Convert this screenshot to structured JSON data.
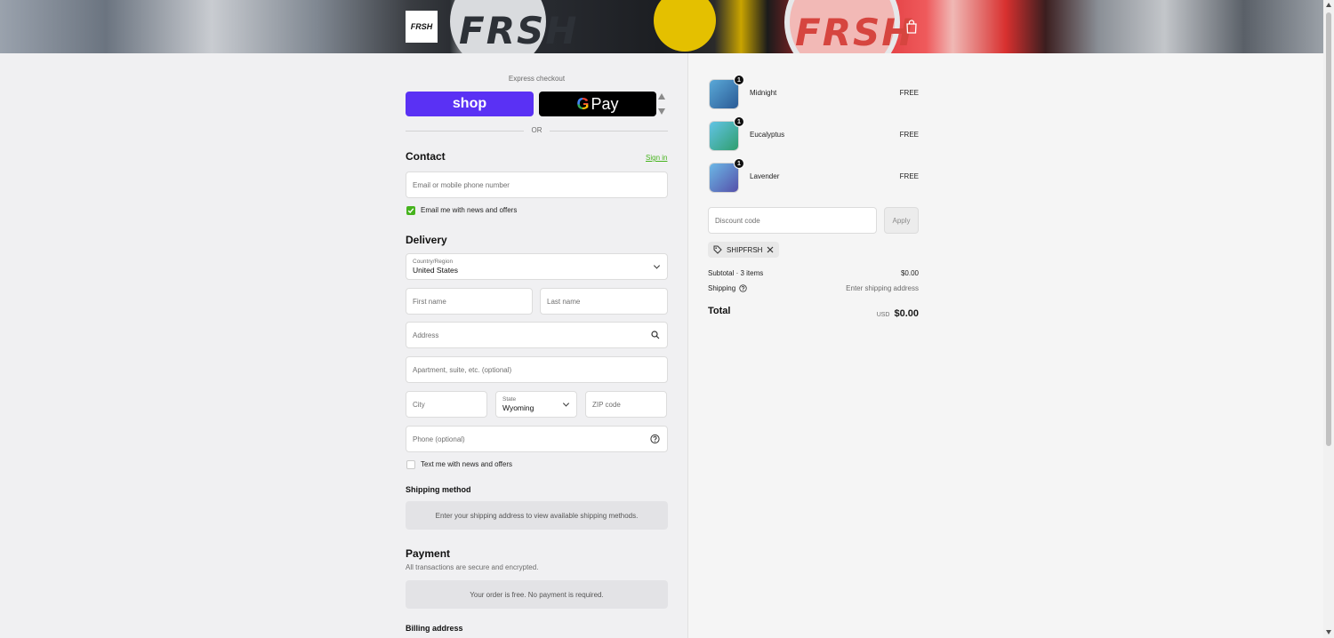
{
  "header": {
    "logo_text": "FRSH",
    "hero_brand": "FRSH",
    "cart_icon": "shopping-bag-icon"
  },
  "express": {
    "label": "Express checkout",
    "shop_label": "shop",
    "gpay_g": "G",
    "gpay_label": "Pay",
    "or_label": "OR"
  },
  "contact": {
    "title": "Contact",
    "sign_in": "Sign in",
    "email_placeholder": "Email or mobile phone number",
    "newsletter_label": "Email me with news and offers",
    "newsletter_checked": true
  },
  "delivery": {
    "title": "Delivery",
    "country_label": "Country/Region",
    "country_value": "United States",
    "first_name_placeholder": "First name",
    "last_name_placeholder": "Last name",
    "address_placeholder": "Address",
    "apartment_placeholder": "Apartment, suite, etc. (optional)",
    "city_placeholder": "City",
    "state_label": "State",
    "state_value": "Wyoming",
    "zip_placeholder": "ZIP code",
    "phone_placeholder": "Phone (optional)",
    "sms_label": "Text me with news and offers",
    "sms_checked": false
  },
  "shipping_method": {
    "title": "Shipping method",
    "message": "Enter your shipping address to view available shipping methods."
  },
  "payment": {
    "title": "Payment",
    "subtitle": "All transactions are secure and encrypted.",
    "message": "Your order is free. No payment is required."
  },
  "billing": {
    "title": "Billing address"
  },
  "summary": {
    "items": [
      {
        "name": "Midnight",
        "qty": "1",
        "price": "FREE",
        "color": "#3b6fa6"
      },
      {
        "name": "Eucalyptus",
        "qty": "1",
        "price": "FREE",
        "color": "#3aa07a"
      },
      {
        "name": "Lavender",
        "qty": "1",
        "price": "FREE",
        "color": "#5a5fb0"
      }
    ],
    "discount_placeholder": "Discount code",
    "apply_label": "Apply",
    "discount_chip": "SHIPFRSH",
    "subtotal_label": "Subtotal · 3 items",
    "subtotal_value": "$0.00",
    "shipping_label": "Shipping",
    "shipping_value": "Enter shipping address",
    "total_label": "Total",
    "total_currency": "USD",
    "total_value": "$0.00"
  },
  "colors": {
    "shop_purple": "#5a31f4",
    "accent_green": "#46b31e"
  }
}
